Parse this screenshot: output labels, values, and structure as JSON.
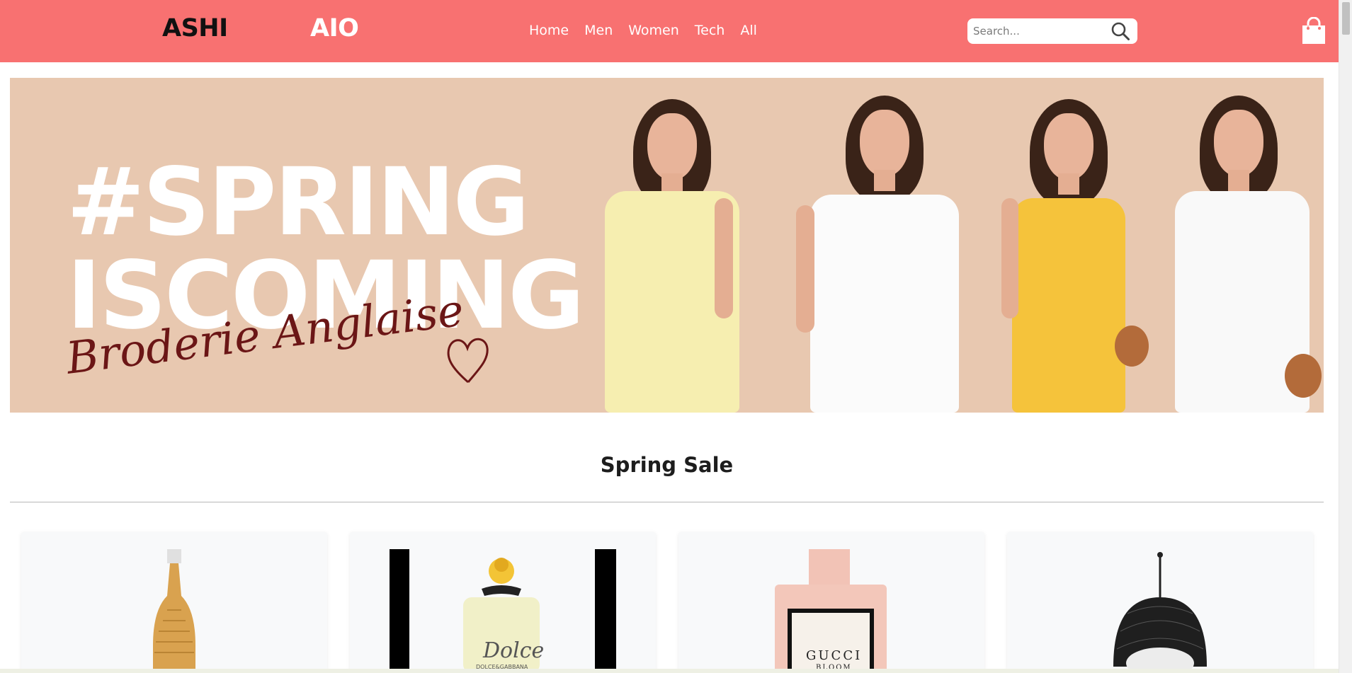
{
  "header": {
    "brand_left": "ASHI",
    "brand_right": "AIO",
    "nav": [
      "Home",
      "Men",
      "Women",
      "Tech",
      "All"
    ],
    "search_placeholder": "Search...",
    "icons": {
      "search": "search-icon",
      "cart": "shopping-bag-icon"
    }
  },
  "colors": {
    "header_bg": "#f87171",
    "hero_bg": "#e8c8b0",
    "script_text": "#6b1616"
  },
  "hero": {
    "line1": "#SPRING",
    "line2": "ISCOMING",
    "script": "Broderie Anglaise"
  },
  "section": {
    "title": "Spring Sale"
  },
  "products": [
    {
      "name": "perfume-gold-bottle"
    },
    {
      "name": "perfume-dolce-gabbana"
    },
    {
      "name": "perfume-gucci-bloom"
    },
    {
      "name": "hanging-egg-chair"
    }
  ],
  "product_labels": {
    "dolce": "Dolce",
    "dolce_brand": "DOLCE&GABBANA",
    "gucci": "GUCCI",
    "gucci_sub": "BLOOM"
  }
}
